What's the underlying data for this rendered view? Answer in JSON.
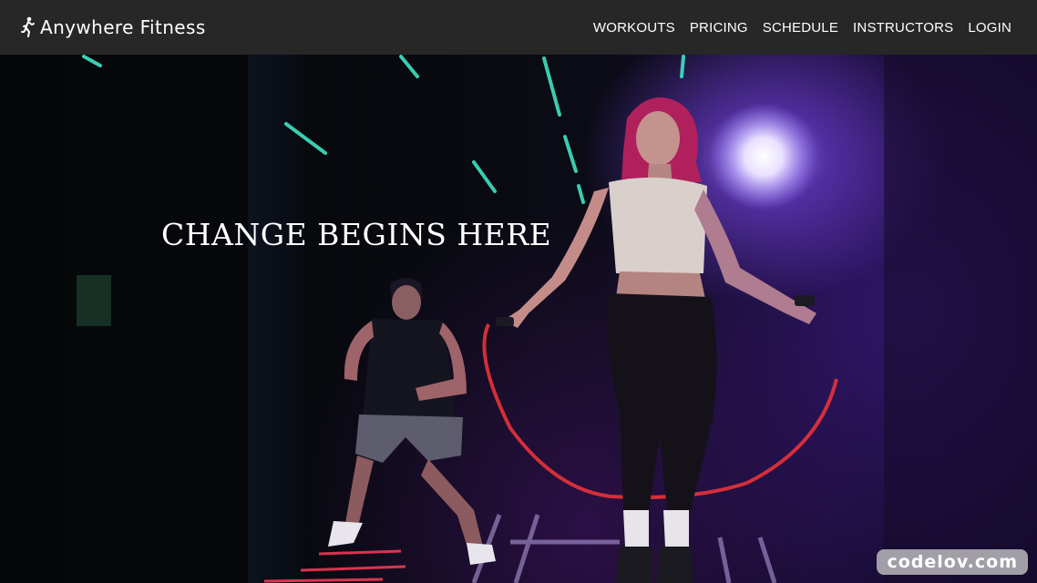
{
  "navbar": {
    "brand": {
      "icon": "running-person-icon",
      "name": "Anywhere Fitness"
    },
    "links": [
      {
        "label": "WORKOUTS"
      },
      {
        "label": "PRICING"
      },
      {
        "label": "SCHEDULE"
      },
      {
        "label": "INSTRUCTORS"
      },
      {
        "label": "LOGIN"
      }
    ]
  },
  "hero": {
    "heading": "CHANGE BEGINS HERE",
    "image": "gym-workout-photo"
  },
  "watermark": {
    "text": "codelov.com"
  }
}
